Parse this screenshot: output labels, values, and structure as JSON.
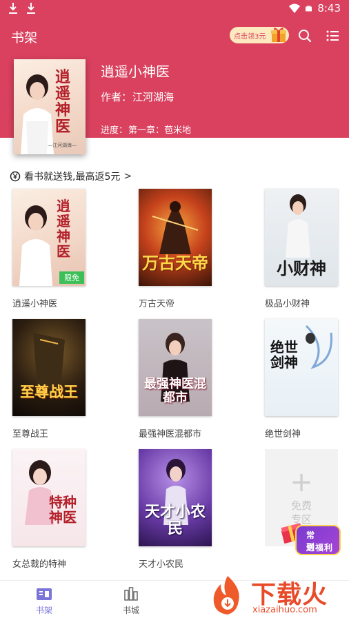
{
  "status_bar": {
    "time": "8:43",
    "left_icons": [
      "download-icon",
      "download-icon"
    ],
    "right_icons": [
      "wifi-icon",
      "battery-icon"
    ]
  },
  "header": {
    "title": "书架",
    "promo_label": "点击领3元",
    "accent_color": "#d9415e",
    "icons": [
      "gift-icon",
      "search-icon",
      "menu-icon"
    ]
  },
  "current_book": {
    "title": "逍遥小神医",
    "author_label": "作者：",
    "author": "江河湖海",
    "progress_label": "进度：",
    "progress": "第一章：苞米地",
    "cover_art_text": "逍遥神医",
    "cover_caption": "—江河湖海—"
  },
  "reward_banner": {
    "text": "看书就送钱,最高返5元",
    "icon": "coin-icon",
    "chevron": ">"
  },
  "books": [
    {
      "name": "逍遥小神医",
      "cover_text": "逍遥神医",
      "badge": "限免"
    },
    {
      "name": "万古天帝",
      "cover_text": "万古天帝",
      "badge": ""
    },
    {
      "name": "极品小财神",
      "cover_text": "小财神",
      "badge": ""
    },
    {
      "name": "至尊战王",
      "cover_text": "至尊战王",
      "badge": ""
    },
    {
      "name": "最强神医混都市",
      "cover_text": "最强神医混都市",
      "badge": ""
    },
    {
      "name": "绝世剑神",
      "cover_text": "绝世剑神",
      "badge": ""
    },
    {
      "name": "女总裁的特神",
      "cover_text": "特种神医",
      "badge": ""
    },
    {
      "name": "天才小农民",
      "cover_text": "天才小农民",
      "badge": ""
    }
  ],
  "add_tile": {
    "plus": "+",
    "label_line1": "免费",
    "label_line2": "专区"
  },
  "welfare_button": {
    "line1": "常到",
    "line2": "送福利"
  },
  "bottom_nav": [
    {
      "label": "书架",
      "icon": "bookshelf-icon",
      "active": true
    },
    {
      "label": "书城",
      "icon": "bookstore-icon",
      "active": false
    }
  ],
  "watermark": {
    "name": "下载火",
    "url": "xiazaihuo.com"
  }
}
